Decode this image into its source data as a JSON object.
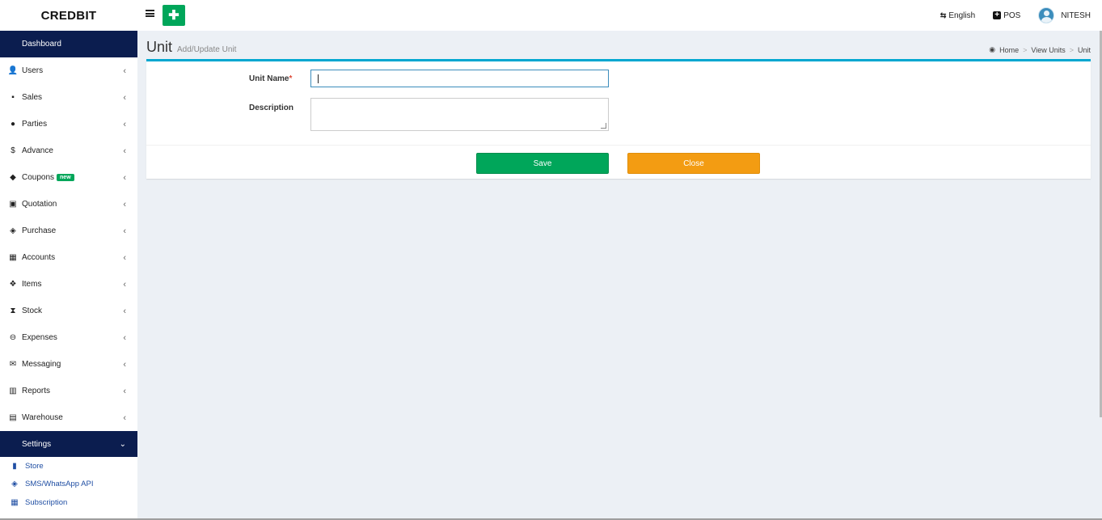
{
  "app": {
    "name": "CREDBIT"
  },
  "topbar": {
    "language": "English",
    "pos": "POS",
    "user": "NITESH"
  },
  "sidebar": {
    "dashboard": "Dashboard",
    "items": [
      {
        "label": "Users",
        "icon": "user-plus-icon"
      },
      {
        "label": "Sales",
        "icon": "cart-icon"
      },
      {
        "label": "Parties",
        "icon": "users-icon"
      },
      {
        "label": "Advance",
        "icon": "dollar-icon"
      },
      {
        "label": "Coupons",
        "icon": "tags-icon",
        "badge": "new"
      },
      {
        "label": "Quotation",
        "icon": "calendar-plus-icon"
      },
      {
        "label": "Purchase",
        "icon": "cube-icon"
      },
      {
        "label": "Accounts",
        "icon": "grid-icon"
      },
      {
        "label": "Items",
        "icon": "cubes-icon"
      },
      {
        "label": "Stock",
        "icon": "hourglass-icon"
      },
      {
        "label": "Expenses",
        "icon": "minus-circle-icon"
      },
      {
        "label": "Messaging",
        "icon": "envelope-icon"
      },
      {
        "label": "Reports",
        "icon": "bar-chart-icon"
      },
      {
        "label": "Warehouse",
        "icon": "building-icon"
      }
    ],
    "settings": {
      "label": "Settings",
      "children": [
        {
          "label": "Store",
          "icon": "briefcase-icon"
        },
        {
          "label": "SMS/WhatsApp API",
          "icon": "cube-icon"
        },
        {
          "label": "Subscription",
          "icon": "calendar-icon"
        }
      ]
    }
  },
  "page": {
    "title": "Unit",
    "subtitle": "Add/Update Unit",
    "breadcrumb": [
      "Home",
      "View Units",
      "Unit"
    ]
  },
  "form": {
    "unit_name_label": "Unit Name",
    "required_mark": "*",
    "unit_name_value": "",
    "description_label": "Description",
    "description_value": "",
    "save_label": "Save",
    "close_label": "Close"
  },
  "colors": {
    "sidebar_active": "#0b1d4f",
    "save": "#00a65a",
    "close": "#f39c12",
    "box_accent": "#00a7d0",
    "link": "#1f4ea3"
  }
}
